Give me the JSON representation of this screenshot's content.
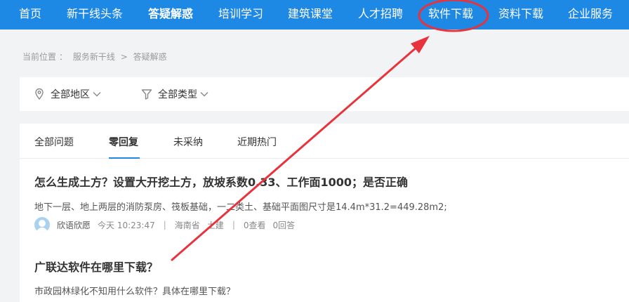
{
  "nav": {
    "items": [
      {
        "label": "首页"
      },
      {
        "label": "新干线头条"
      },
      {
        "label": "答疑解惑",
        "active": true
      },
      {
        "label": "培训学习"
      },
      {
        "label": "建筑课堂"
      },
      {
        "label": "人才招聘"
      },
      {
        "label": "软件下载"
      },
      {
        "label": "资料下载"
      },
      {
        "label": "企业服务"
      }
    ]
  },
  "breadcrumb": {
    "prefix": "当前位置",
    "colon": "：",
    "home": "服务新干线",
    "arrow": ">",
    "current": "答疑解惑"
  },
  "filters": {
    "region": "全部地区",
    "type": "全部类型"
  },
  "tabs": [
    {
      "label": "全部问题"
    },
    {
      "label": "零回复",
      "active": true
    },
    {
      "label": "未采纳"
    },
    {
      "label": "近期热门"
    }
  ],
  "questions": [
    {
      "title": "怎么生成土方？设置大开挖土方，放坡系数0.33、工作面1000；是否正确",
      "desc": "地下一层、地上两层的消防泵房、筏板基础，一二类土、基础平面图尺寸是14.4m*31.2=449.28m2;",
      "user": "欣语欣愿",
      "time": "今天 10:23:47",
      "region": "海南省",
      "category": "土建",
      "views": "0查看",
      "answers": "0回答"
    },
    {
      "title": "广联达软件在哪里下载？",
      "desc": "市政园林绿化不知用什么软件？具体在哪里下载？"
    }
  ],
  "colors": {
    "nav_bg": "#1e88e5",
    "annotation": "#e8333c"
  }
}
